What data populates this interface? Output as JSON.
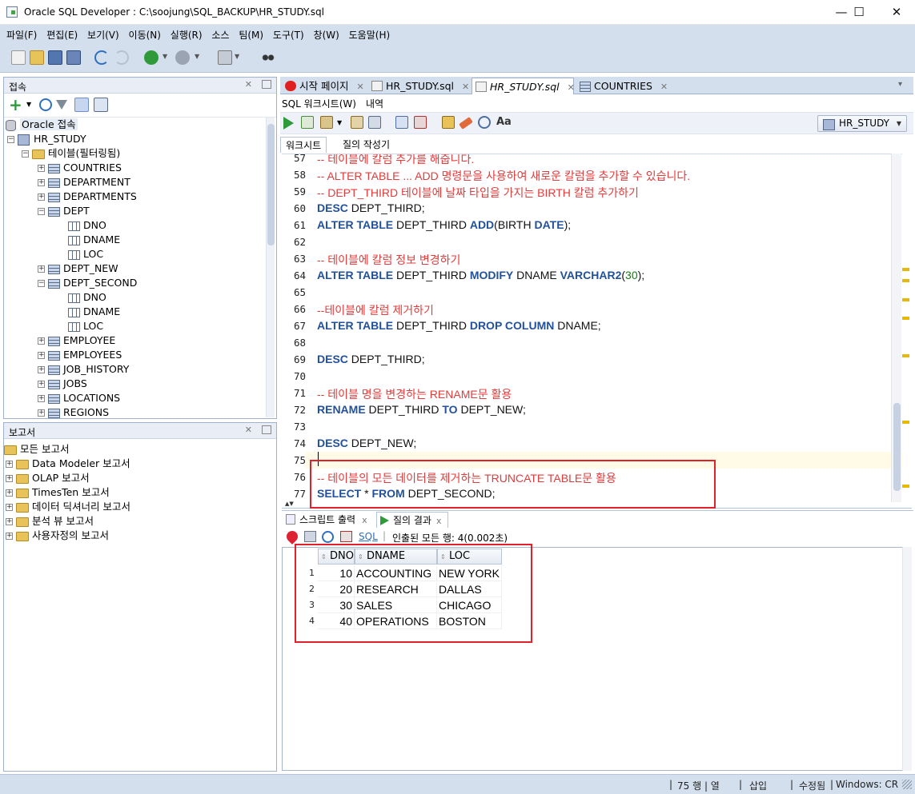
{
  "window": {
    "title": "Oracle SQL Developer : C:\\soojung\\SQL_BACKUP\\HR_STUDY.sql",
    "minimize": "—",
    "maximize": "☐",
    "close": "✕"
  },
  "menu": [
    "파일(F)",
    "편집(E)",
    "보기(V)",
    "이동(N)",
    "실행(R)",
    "소스",
    "팀(M)",
    "도구(T)",
    "창(W)",
    "도움말(H)"
  ],
  "connections_panel": {
    "title": "접속",
    "root": "Oracle 접속",
    "connection": "HR_STUDY",
    "tables_folder": "테이블(필터링됨)",
    "items": [
      {
        "label": "COUNTRIES",
        "type": "table",
        "expanded": false
      },
      {
        "label": "DEPARTMENT",
        "type": "table",
        "expanded": false
      },
      {
        "label": "DEPARTMENTS",
        "type": "table",
        "expanded": false
      },
      {
        "label": "DEPT",
        "type": "table",
        "expanded": true
      },
      {
        "label": "DNO",
        "type": "column"
      },
      {
        "label": "DNAME",
        "type": "column"
      },
      {
        "label": "LOC",
        "type": "column"
      },
      {
        "label": "DEPT_NEW",
        "type": "table",
        "expanded": false
      },
      {
        "label": "DEPT_SECOND",
        "type": "table",
        "expanded": true
      },
      {
        "label": "DNO",
        "type": "column"
      },
      {
        "label": "DNAME",
        "type": "column"
      },
      {
        "label": "LOC",
        "type": "column"
      },
      {
        "label": "EMPLOYEE",
        "type": "table",
        "expanded": false
      },
      {
        "label": "EMPLOYEES",
        "type": "table",
        "expanded": false
      },
      {
        "label": "JOB_HISTORY",
        "type": "table",
        "expanded": false
      },
      {
        "label": "JOBS",
        "type": "table",
        "expanded": false
      },
      {
        "label": "LOCATIONS",
        "type": "table",
        "expanded": false
      },
      {
        "label": "REGIONS",
        "type": "table",
        "expanded": false
      }
    ]
  },
  "reports_panel": {
    "title": "보고서",
    "root": "모든 보고서",
    "items": [
      "Data Modeler 보고서",
      "OLAP 보고서",
      "TimesTen 보고서",
      "데이터 딕셔너리 보고서",
      "분석 뷰 보고서",
      "사용자정의 보고서"
    ]
  },
  "doc_tabs": [
    {
      "label": "시작 페이지",
      "active": false
    },
    {
      "label": "HR_STUDY.sql",
      "active": false
    },
    {
      "label": "HR_STUDY.sql",
      "active": true
    },
    {
      "label": "COUNTRIES",
      "active": false
    }
  ],
  "sub_tabs": {
    "worksheet": "SQL 워크시트(W)",
    "history": "내역"
  },
  "connection_selector": "HR_STUDY",
  "worksheet_tabs": {
    "worksheet": "워크시트",
    "query_builder": "질의 작성기"
  },
  "editor": {
    "current_line": 75,
    "lines": [
      {
        "n": "57",
        "tokens": [
          {
            "t": "-- 테이블에 칼럼 추가를 해줍니다.",
            "c": "cmt"
          }
        ]
      },
      {
        "n": "58",
        "tokens": [
          {
            "t": "-- ALTER TABLE ... ADD 명령문을 사용하여 새로운 칼럼을 추가할 수 있습니다.",
            "c": "cmt"
          }
        ]
      },
      {
        "n": "59",
        "tokens": [
          {
            "t": "-- DEPT_THIRD 테이블에 날짜 타입을 가지는 BIRTH 칼럼 추가하기",
            "c": "cmt"
          }
        ]
      },
      {
        "n": "60",
        "tokens": [
          {
            "t": "DESC",
            "c": "kw"
          },
          {
            "t": " DEPT_THIRD;",
            "c": "id"
          }
        ]
      },
      {
        "n": "61",
        "tokens": [
          {
            "t": "ALTER TABLE",
            "c": "kw"
          },
          {
            "t": " DEPT_THIRD ",
            "c": "id"
          },
          {
            "t": "ADD",
            "c": "kw"
          },
          {
            "t": "(BIRTH ",
            "c": "id"
          },
          {
            "t": "DATE",
            "c": "kw"
          },
          {
            "t": ");",
            "c": "id"
          }
        ]
      },
      {
        "n": "62",
        "tokens": []
      },
      {
        "n": "63",
        "tokens": [
          {
            "t": "-- 테이블에 칼럼 정보 변경하기",
            "c": "cmt"
          }
        ]
      },
      {
        "n": "64",
        "tokens": [
          {
            "t": "ALTER TABLE",
            "c": "kw"
          },
          {
            "t": " DEPT_THIRD ",
            "c": "id"
          },
          {
            "t": "MODIFY",
            "c": "kw"
          },
          {
            "t": " DNAME ",
            "c": "id"
          },
          {
            "t": "VARCHAR2",
            "c": "kw"
          },
          {
            "t": "(",
            "c": "id"
          },
          {
            "t": "30",
            "c": "num"
          },
          {
            "t": ");",
            "c": "id"
          }
        ]
      },
      {
        "n": "65",
        "tokens": []
      },
      {
        "n": "66",
        "tokens": [
          {
            "t": "--테이블에 칼럼 제거하기",
            "c": "cmt"
          }
        ]
      },
      {
        "n": "67",
        "tokens": [
          {
            "t": "ALTER TABLE",
            "c": "kw"
          },
          {
            "t": " DEPT_THIRD ",
            "c": "id"
          },
          {
            "t": "DROP COLUMN",
            "c": "kw"
          },
          {
            "t": " DNAME;",
            "c": "id"
          }
        ]
      },
      {
        "n": "68",
        "tokens": []
      },
      {
        "n": "69",
        "tokens": [
          {
            "t": "DESC",
            "c": "kw"
          },
          {
            "t": " DEPT_THIRD;",
            "c": "id"
          }
        ]
      },
      {
        "n": "70",
        "tokens": []
      },
      {
        "n": "71",
        "tokens": [
          {
            "t": "-- 테이블 명을 변경하는 RENAME문 활용",
            "c": "cmt"
          }
        ]
      },
      {
        "n": "72",
        "tokens": [
          {
            "t": "RENAME",
            "c": "kw"
          },
          {
            "t": " DEPT_THIRD ",
            "c": "id"
          },
          {
            "t": "TO",
            "c": "kw"
          },
          {
            "t": " DEPT_NEW;",
            "c": "id"
          }
        ]
      },
      {
        "n": "73",
        "tokens": []
      },
      {
        "n": "74",
        "tokens": [
          {
            "t": "DESC",
            "c": "kw"
          },
          {
            "t": " DEPT_NEW;",
            "c": "id"
          }
        ]
      },
      {
        "n": "75",
        "tokens": []
      },
      {
        "n": "76",
        "tokens": [
          {
            "t": "-- 테이블의 모든 데이터를 제거하는 TRUNCATE TABLE문 활용",
            "c": "cmt"
          }
        ]
      },
      {
        "n": "77",
        "tokens": [
          {
            "t": "SELECT",
            "c": "kw"
          },
          {
            "t": " * ",
            "c": "id"
          },
          {
            "t": "FROM",
            "c": "kw"
          },
          {
            "t": " DEPT_SECOND;",
            "c": "id"
          }
        ]
      }
    ]
  },
  "output_tabs": {
    "script_output": "스크립트 출력",
    "query_result": "질의 결과"
  },
  "output_toolbar": {
    "sql_link": "SQL",
    "status": "인출된 모든 행: 4(0.002초)"
  },
  "result_grid": {
    "columns": [
      "DNO",
      "DNAME",
      "LOC"
    ],
    "rows": [
      {
        "n": "1",
        "cells": [
          "10",
          "ACCOUNTING",
          "NEW YORK"
        ]
      },
      {
        "n": "2",
        "cells": [
          "20",
          "RESEARCH",
          "DALLAS"
        ]
      },
      {
        "n": "3",
        "cells": [
          "30",
          "SALES",
          "CHICAGO"
        ]
      },
      {
        "n": "4",
        "cells": [
          "40",
          "OPERATIONS",
          "BOSTON"
        ]
      }
    ]
  },
  "status_bar": {
    "position": "75 행 | 열",
    "insert_mode": "삽입",
    "modified": "수정됨",
    "line_ending": "Windows: CR"
  },
  "colors": {
    "chrome": "#d4dfee",
    "comment": "#e23b3b",
    "keyword": "#22519b",
    "highlight_box": "#e0202a"
  }
}
